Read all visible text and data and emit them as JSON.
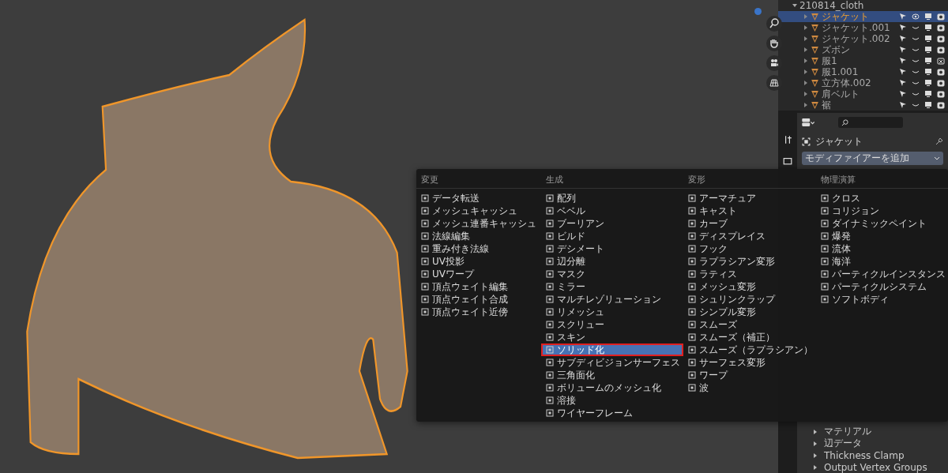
{
  "outliner": {
    "collection": "210814_cloth",
    "items": [
      {
        "name": "ジャケット",
        "selected": true,
        "visible": true,
        "renderable": true
      },
      {
        "name": "ジャケット.001",
        "selected": false,
        "visible": false,
        "renderable": true
      },
      {
        "name": "ジャケット.002",
        "selected": false,
        "visible": false,
        "renderable": true
      },
      {
        "name": "ズボン",
        "selected": false,
        "visible": false,
        "renderable": true
      },
      {
        "name": "服1",
        "selected": false,
        "visible": false,
        "renderable": false
      },
      {
        "name": "服1.001",
        "selected": false,
        "visible": false,
        "renderable": true
      },
      {
        "name": "立方体.002",
        "selected": false,
        "visible": false,
        "renderable": true
      },
      {
        "name": "肩ベルト",
        "selected": false,
        "visible": false,
        "renderable": true
      },
      {
        "name": "裾",
        "selected": false,
        "visible": false,
        "renderable": true
      }
    ]
  },
  "properties": {
    "object_name": "ジャケット",
    "add_modifier": "モディファイアーを追加",
    "panels": [
      {
        "label": "マテリアル",
        "expanded": false
      },
      {
        "label": "辺データ",
        "expanded": false
      },
      {
        "label": "Thickness Clamp",
        "expanded": false
      },
      {
        "label": "Output Vertex Groups",
        "expanded": false
      }
    ]
  },
  "menu": {
    "columns": [
      {
        "title": "変更",
        "items": [
          {
            "label": "データ転送",
            "selected": false,
            "annotated": false
          },
          {
            "label": "メッシュキャッシュ",
            "selected": false,
            "annotated": false
          },
          {
            "label": "メッシュ連番キャッシュ",
            "selected": false,
            "annotated": false
          },
          {
            "label": "法線編集",
            "selected": false,
            "annotated": false
          },
          {
            "label": "重み付き法線",
            "selected": false,
            "annotated": false
          },
          {
            "label": "UV投影",
            "selected": false,
            "annotated": false
          },
          {
            "label": "UVワープ",
            "selected": false,
            "annotated": false
          },
          {
            "label": "頂点ウェイト編集",
            "selected": false,
            "annotated": false
          },
          {
            "label": "頂点ウェイト合成",
            "selected": false,
            "annotated": false
          },
          {
            "label": "頂点ウェイト近傍",
            "selected": false,
            "annotated": false
          }
        ]
      },
      {
        "title": "生成",
        "items": [
          {
            "label": "配列",
            "selected": false,
            "annotated": false
          },
          {
            "label": "ベベル",
            "selected": false,
            "annotated": false
          },
          {
            "label": "ブーリアン",
            "selected": false,
            "annotated": false
          },
          {
            "label": "ビルド",
            "selected": false,
            "annotated": false
          },
          {
            "label": "デシメート",
            "selected": false,
            "annotated": false
          },
          {
            "label": "辺分離",
            "selected": false,
            "annotated": false
          },
          {
            "label": "マスク",
            "selected": false,
            "annotated": false
          },
          {
            "label": "ミラー",
            "selected": false,
            "annotated": false
          },
          {
            "label": "マルチレゾリューション",
            "selected": false,
            "annotated": false
          },
          {
            "label": "リメッシュ",
            "selected": false,
            "annotated": false
          },
          {
            "label": "スクリュー",
            "selected": false,
            "annotated": false
          },
          {
            "label": "スキン",
            "selected": false,
            "annotated": false
          },
          {
            "label": "ソリッド化",
            "selected": true,
            "annotated": true
          },
          {
            "label": "サブディビジョンサーフェス",
            "selected": false,
            "annotated": false
          },
          {
            "label": "三角面化",
            "selected": false,
            "annotated": false
          },
          {
            "label": "ボリュームのメッシュ化",
            "selected": false,
            "annotated": false
          },
          {
            "label": "溶接",
            "selected": false,
            "annotated": false
          },
          {
            "label": "ワイヤーフレーム",
            "selected": false,
            "annotated": false
          }
        ]
      },
      {
        "title": "変形",
        "items": [
          {
            "label": "アーマチュア",
            "selected": false,
            "annotated": false
          },
          {
            "label": "キャスト",
            "selected": false,
            "annotated": false
          },
          {
            "label": "カーブ",
            "selected": false,
            "annotated": false
          },
          {
            "label": "ディスプレイス",
            "selected": false,
            "annotated": false
          },
          {
            "label": "フック",
            "selected": false,
            "annotated": false
          },
          {
            "label": "ラプラシアン変形",
            "selected": false,
            "annotated": false
          },
          {
            "label": "ラティス",
            "selected": false,
            "annotated": false
          },
          {
            "label": "メッシュ変形",
            "selected": false,
            "annotated": false
          },
          {
            "label": "シュリンクラップ",
            "selected": false,
            "annotated": false
          },
          {
            "label": "シンプル変形",
            "selected": false,
            "annotated": false
          },
          {
            "label": "スムーズ",
            "selected": false,
            "annotated": false
          },
          {
            "label": "スムーズ（補正）",
            "selected": false,
            "annotated": false
          },
          {
            "label": "スムーズ（ラプラシアン）",
            "selected": false,
            "annotated": false
          },
          {
            "label": "サーフェス変形",
            "selected": false,
            "annotated": false
          },
          {
            "label": "ワープ",
            "selected": false,
            "annotated": false
          },
          {
            "label": "波",
            "selected": false,
            "annotated": false
          }
        ]
      },
      {
        "title": "物理演算",
        "items": [
          {
            "label": "クロス",
            "selected": false,
            "annotated": false
          },
          {
            "label": "コリジョン",
            "selected": false,
            "annotated": false
          },
          {
            "label": "ダイナミックペイント",
            "selected": false,
            "annotated": false
          },
          {
            "label": "爆発",
            "selected": false,
            "annotated": false
          },
          {
            "label": "流体",
            "selected": false,
            "annotated": false
          },
          {
            "label": "海洋",
            "selected": false,
            "annotated": false
          },
          {
            "label": "パーティクルインスタンス",
            "selected": false,
            "annotated": false
          },
          {
            "label": "パーティクルシステム",
            "selected": false,
            "annotated": false
          },
          {
            "label": "ソフトボディ",
            "selected": false,
            "annotated": false
          }
        ]
      }
    ]
  }
}
